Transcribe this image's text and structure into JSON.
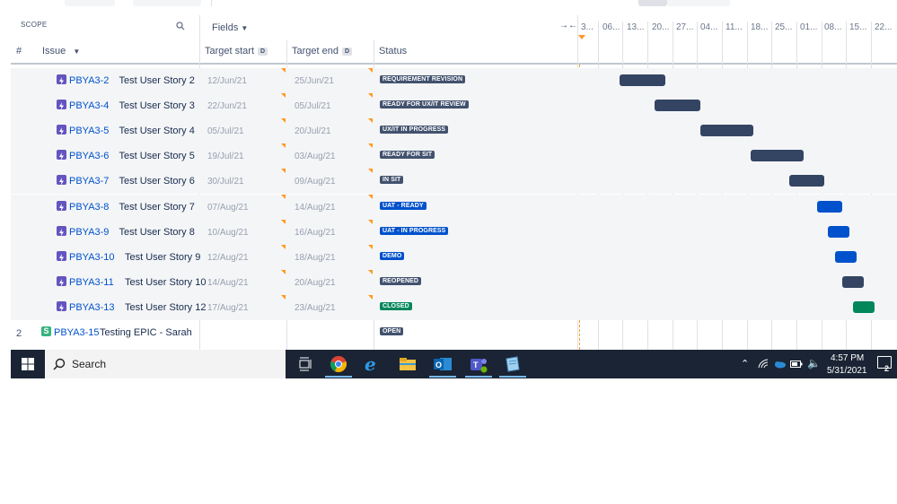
{
  "header": {
    "scope_label": "SCOPE",
    "fields_label": "Fields",
    "columns": {
      "hash": "#",
      "issue": "Issue",
      "target_start": "Target start",
      "target_end": "Target end",
      "status": "Status",
      "d_badge": "D"
    }
  },
  "timeline": {
    "collapse_icon": "collapse-arrows-icon",
    "dates": [
      "3...",
      "06...",
      "13...",
      "20...",
      "27...",
      "04...",
      "11...",
      "18...",
      "25...",
      "01...",
      "08...",
      "15...",
      "22..."
    ]
  },
  "rows": [
    {
      "num": "",
      "key": "PBYA3-2",
      "summary": "Test User Story 2",
      "start": "12/Jun/21",
      "end": "25/Jun/21",
      "status": "REQUIREMENT REVISION",
      "status_color": "#42526e",
      "bar_color": "#344563"
    },
    {
      "num": "",
      "key": "PBYA3-4",
      "summary": "Test User Story 3",
      "start": "22/Jun/21",
      "end": "05/Jul/21",
      "status": "READY FOR UX/IT REVIEW",
      "status_color": "#42526e",
      "bar_color": "#344563"
    },
    {
      "num": "",
      "key": "PBYA3-5",
      "summary": "Test User Story 4",
      "start": "05/Jul/21",
      "end": "20/Jul/21",
      "status": "UX/IT IN PROGRESS",
      "status_color": "#42526e",
      "bar_color": "#344563"
    },
    {
      "num": "",
      "key": "PBYA3-6",
      "summary": "Test User Story 5",
      "start": "19/Jul/21",
      "end": "03/Aug/21",
      "status": "READY FOR SIT",
      "status_color": "#42526e",
      "bar_color": "#344563"
    },
    {
      "num": "",
      "key": "PBYA3-7",
      "summary": "Test User Story 6",
      "start": "30/Jul/21",
      "end": "09/Aug/21",
      "status": "IN SIT",
      "status_color": "#42526e",
      "bar_color": "#344563"
    },
    {
      "num": "",
      "key": "PBYA3-8",
      "summary": "Test User Story 7",
      "start": "07/Aug/21",
      "end": "14/Aug/21",
      "status": "UAT - READY",
      "status_color": "#0052cc",
      "bar_color": "#0052cc"
    },
    {
      "num": "",
      "key": "PBYA3-9",
      "summary": "Test User Story 8",
      "start": "10/Aug/21",
      "end": "16/Aug/21",
      "status": "UAT - IN PROGRESS",
      "status_color": "#0052cc",
      "bar_color": "#0052cc"
    },
    {
      "num": "",
      "key": "PBYA3-10",
      "summary": "Test User Story 9",
      "start": "12/Aug/21",
      "end": "18/Aug/21",
      "status": "DEMO",
      "status_color": "#0052cc",
      "bar_color": "#0052cc"
    },
    {
      "num": "",
      "key": "PBYA3-11",
      "summary": "Test User Story 10",
      "start": "14/Aug/21",
      "end": "20/Aug/21",
      "status": "REOPENED",
      "status_color": "#42526e",
      "bar_color": "#344563"
    },
    {
      "num": "",
      "key": "PBYA3-13",
      "summary": "Test User Story 12",
      "start": "17/Aug/21",
      "end": "23/Aug/21",
      "status": "CLOSED",
      "status_color": "#00875a",
      "bar_color": "#00875a"
    }
  ],
  "epic": {
    "num": "2",
    "icon_letter": "S",
    "key": "PBYA3-15",
    "summary": "Testing EPIC - Sarah",
    "status": "OPEN",
    "status_color": "#42526e"
  },
  "taskbar": {
    "search_label": "Search",
    "apps": [
      "task-view-icon",
      "chrome-icon",
      "edge-icon",
      "file-explorer-icon",
      "outlook-icon",
      "teams-icon",
      "notepad-icon"
    ],
    "time": "4:57 PM",
    "date": "5/31/2021",
    "notification_count": "2"
  }
}
